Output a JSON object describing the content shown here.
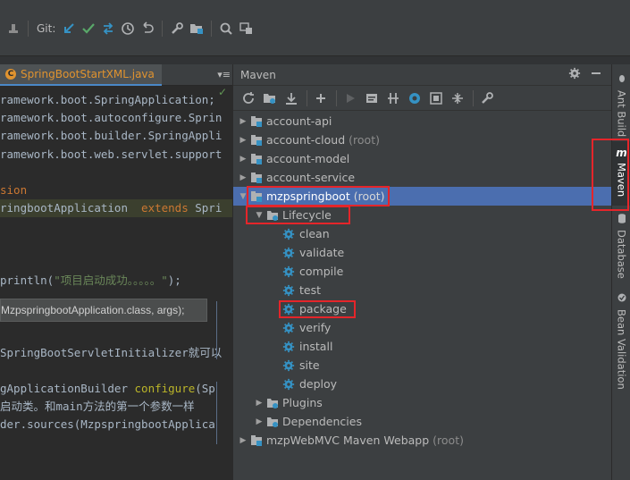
{
  "toolbar": {
    "git_label": "Git:"
  },
  "editor": {
    "tab_label": "SpringBootStartXML.java",
    "tab_menu": "▾≡",
    "lines": [
      {
        "text": "ramework.boot.SpringApplication;"
      },
      {
        "text": "ramework.boot.autoconfigure.Sprin"
      },
      {
        "text": "ramework.boot.builder.SpringAppli"
      },
      {
        "text": "ramework.boot.web.servlet.support"
      },
      {
        "text": ""
      },
      {
        "text": "sion"
      },
      {
        "text": "ringbootApplication  extends Spri"
      },
      {
        "text": ""
      },
      {
        "text": ""
      },
      {
        "text": ""
      },
      {
        "text": "println(\"项目启动成功。。。。。\");"
      },
      {
        "text": ""
      },
      {
        "text": ""
      },
      {
        "text": ""
      },
      {
        "text": "SpringBootServletInitializer就可以"
      },
      {
        "text": ""
      },
      {
        "text": "gApplicationBuilder configure(Sp"
      },
      {
        "text": "启动类。和main方法的第一个参数一样"
      },
      {
        "text": "der.sources(MzpspringbootApplica"
      }
    ],
    "tooltip": "MzpspringbootApplication.class, args);"
  },
  "maven": {
    "title": "Maven",
    "tree": [
      {
        "label": "account-api",
        "suffix": "",
        "level": 0,
        "arrow": "▶",
        "icon": "module-icon"
      },
      {
        "label": "account-cloud",
        "suffix": "(root)",
        "level": 0,
        "arrow": "▶",
        "icon": "module-icon"
      },
      {
        "label": "account-model",
        "suffix": "",
        "level": 0,
        "arrow": "▶",
        "icon": "module-icon"
      },
      {
        "label": "account-service",
        "suffix": "",
        "level": 0,
        "arrow": "▶",
        "icon": "module-icon"
      },
      {
        "label": "mzpspringboot",
        "suffix": "(root)",
        "level": 0,
        "arrow": "▼",
        "icon": "module-icon",
        "selected": true
      },
      {
        "label": "Lifecycle",
        "suffix": "",
        "level": 1,
        "arrow": "▼",
        "icon": "folder-icon"
      },
      {
        "label": "clean",
        "suffix": "",
        "level": 2,
        "arrow": "",
        "icon": "gear-icon"
      },
      {
        "label": "validate",
        "suffix": "",
        "level": 2,
        "arrow": "",
        "icon": "gear-icon"
      },
      {
        "label": "compile",
        "suffix": "",
        "level": 2,
        "arrow": "",
        "icon": "gear-icon"
      },
      {
        "label": "test",
        "suffix": "",
        "level": 2,
        "arrow": "",
        "icon": "gear-icon"
      },
      {
        "label": "package",
        "suffix": "",
        "level": 2,
        "arrow": "",
        "icon": "gear-icon"
      },
      {
        "label": "verify",
        "suffix": "",
        "level": 2,
        "arrow": "",
        "icon": "gear-icon"
      },
      {
        "label": "install",
        "suffix": "",
        "level": 2,
        "arrow": "",
        "icon": "gear-icon"
      },
      {
        "label": "site",
        "suffix": "",
        "level": 2,
        "arrow": "",
        "icon": "gear-icon"
      },
      {
        "label": "deploy",
        "suffix": "",
        "level": 2,
        "arrow": "",
        "icon": "gear-icon"
      },
      {
        "label": "Plugins",
        "suffix": "",
        "level": 1,
        "arrow": "▶",
        "icon": "folder-icon"
      },
      {
        "label": "Dependencies",
        "suffix": "",
        "level": 1,
        "arrow": "▶",
        "icon": "folder-icon"
      },
      {
        "label": "mzpWebMVC Maven Webapp",
        "suffix": "(root)",
        "level": 0,
        "arrow": "▶",
        "icon": "module-icon"
      }
    ]
  },
  "side_tabs": [
    {
      "label": "Ant Build",
      "icon": "ant-icon"
    },
    {
      "label": "Maven",
      "icon": "maven-icon",
      "active": true
    },
    {
      "label": "Database",
      "icon": "database-icon"
    },
    {
      "label": "Bean Validation",
      "icon": "bean-validation-icon"
    }
  ],
  "colors": {
    "accent_blue": "#4a88c7",
    "selection": "#4b6eaf",
    "annotation_red": "#e5252a",
    "check_green": "#59a869"
  }
}
